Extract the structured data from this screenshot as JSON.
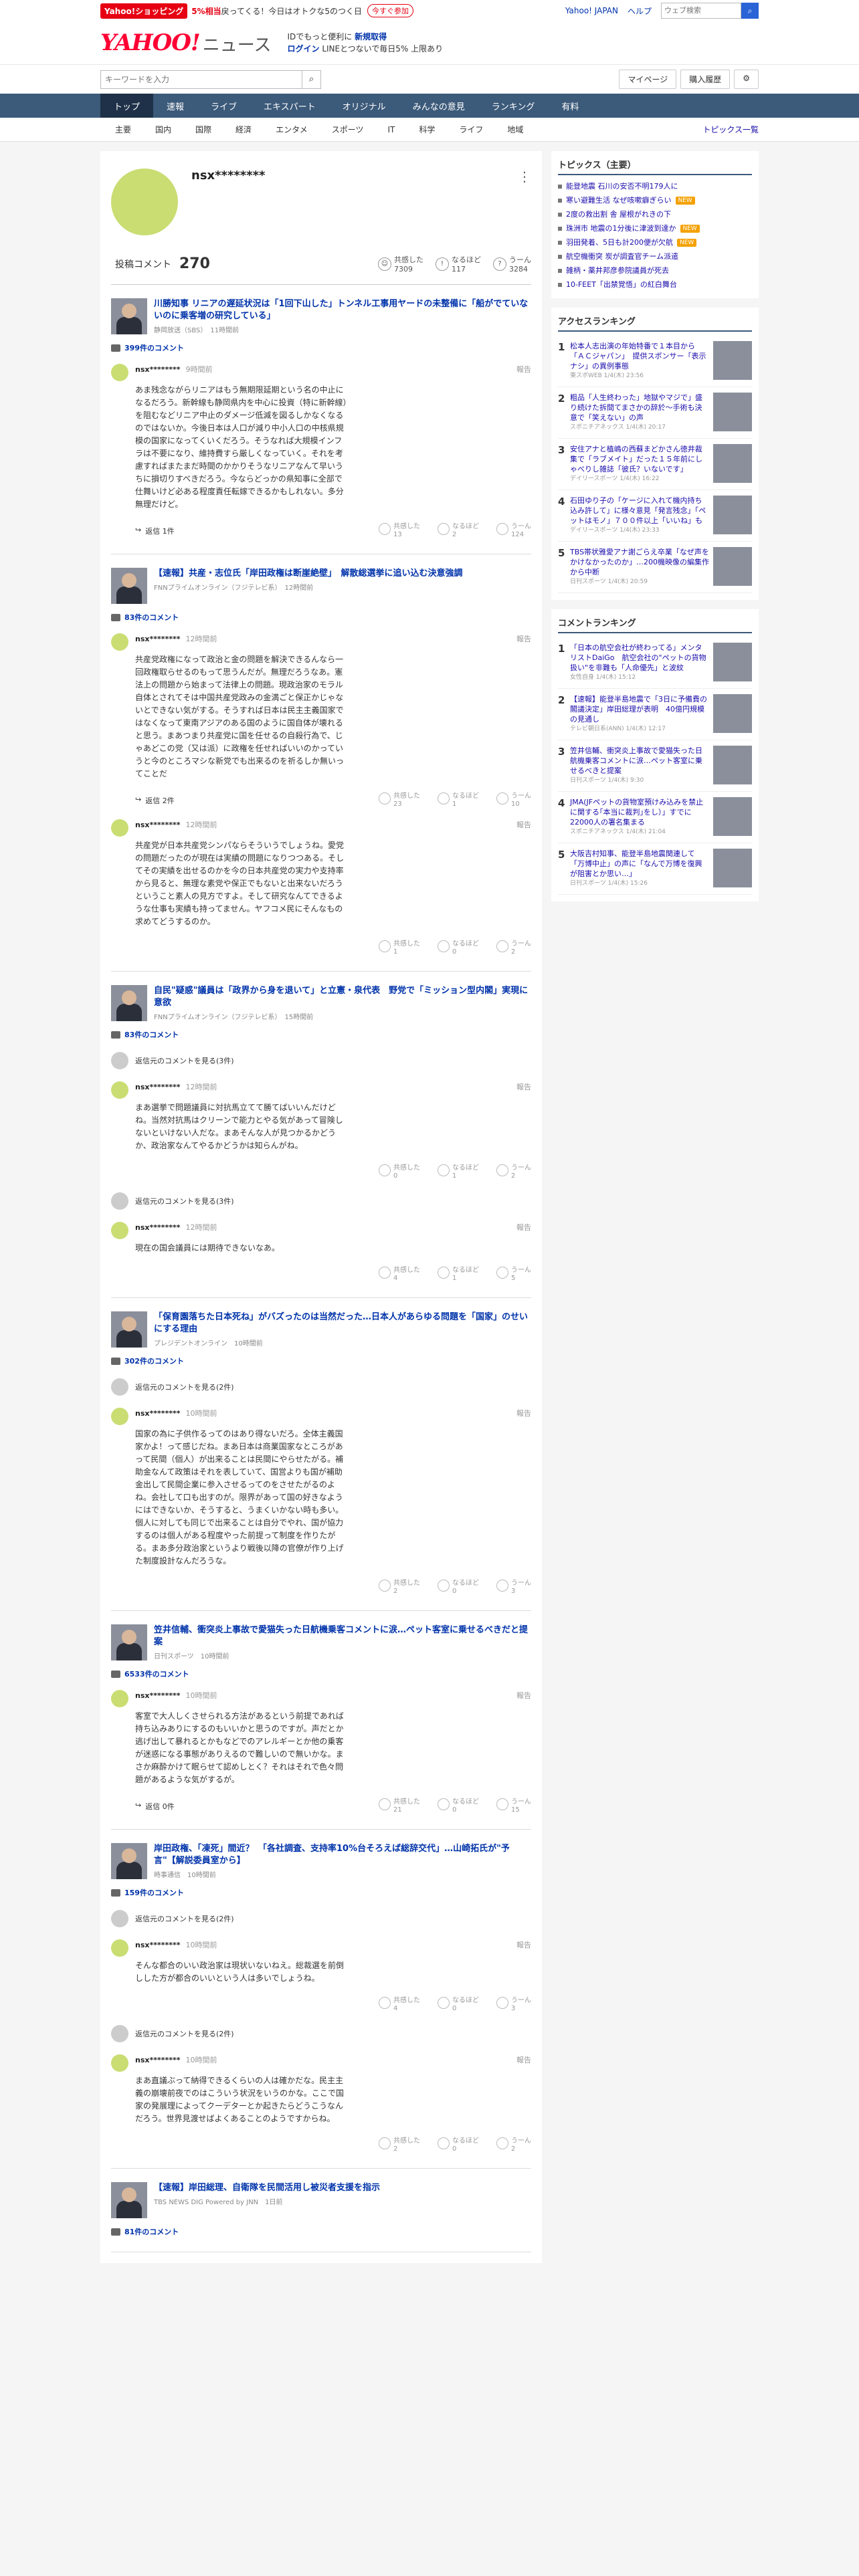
{
  "topbar": {
    "shop": "Yahoo!ショッピング",
    "promo_pre": "5%相当",
    "promo_post": "戻ってくる！今日はオトクな5のつく日",
    "promo_btn": "今すぐ参加",
    "links": [
      "Yahoo! JAPAN",
      "ヘルプ"
    ],
    "search_placeholder": "ウェブ検索"
  },
  "header": {
    "logo": "YAHOO!",
    "logo_sub_text": "JAPAN",
    "site": "ニュース",
    "line1_pre": "IDでもっと便利に",
    "line1_link": "新規取得",
    "line2_login": "ログイン",
    "line2_text": "LINEとつないで毎日5%",
    "line2_tail": "上限あり"
  },
  "searchrow": {
    "placeholder": "キーワードを入力",
    "mypage": "マイページ",
    "buy": "購入履歴"
  },
  "mainnav": [
    "トップ",
    "速報",
    "ライブ",
    "エキスパート",
    "オリジナル",
    "みんなの意見",
    "ランキング",
    "有料"
  ],
  "subnav": {
    "items": [
      "主要",
      "国内",
      "国際",
      "経済",
      "エンタメ",
      "スポーツ",
      "IT",
      "科学",
      "ライフ",
      "地域"
    ],
    "all": "トピックス一覧"
  },
  "profile": {
    "name": "nsx********",
    "comment_label": "投稿コメント",
    "comment_count": "270",
    "kyokan_label": "共感した",
    "kyokan": "7309",
    "naruhodo_label": "なるほど",
    "naruhodo": "117",
    "un_label": "うーん",
    "un": "3284"
  },
  "articles": [
    {
      "title": "川勝知事 リニアの遅延状況は「1回下山した」トンネル工事用ヤードの未整備に「船がでていないのに乗客増の研究している」",
      "src": "静岡放送（SBS）　11時間前",
      "count": "399件のコメント",
      "comments": [
        {
          "user": "nsx********",
          "time": "9時間前",
          "text": "あま残念ながらリニアはもう無期限延期という名の中止になるだろう。新幹線も静岡県内を中心に投資（特に新幹線）を阻むなどリニア中止のダメージ低減を図るしかなくなるのではないか。今後日本は人口が減り中小人口の中核県規模の国家になってくいくだろう。そうなれば大規模インフラは不要になり、維持費すら厳しくなっていく。それを考慮すればまたまだ時間のかかりそうなリニアなんて早いうちに損切りすべきだろう。今ならどっかの県知事に全部で仕舞いけど必ある程度責任転嫁できるかもしれない。多分無理だけど。",
          "reply": "返信 1件",
          "k": "13",
          "n": "2",
          "u": "124"
        }
      ]
    },
    {
      "title": "【速報】共産・志位氏「岸田政権は断崖絶壁」　解散総選挙に追い込む決意強調",
      "src": "FNNプライムオンライン（フジテレビ系）　12時間前",
      "count": "83件のコメント",
      "comments": [
        {
          "user": "nsx********",
          "time": "12時間前",
          "text": "共産党政権になって政治と金の問題を解決できるんなら一回政権取らせるのもって思うんだが。無理だろうなあ。憲法上の問題から始まって法律上の問題。現政治家のモラル自体とされてそは中国共産党政みの金満ごと保正かじゃないとできない気がする。そうすれば日本は民主主義国家ではなくなって東南アジアのある国のように国自体が壊れると思う。まあつまり共産党に国を任せるの自殺行為で、じゃあどこの党（又は派）に政権を任せればいいのかっていうと今のところマシな新党でも出来るのを祈るしか無いってことだ",
          "reply": "返信 2件",
          "k": "23",
          "n": "1",
          "u": "10"
        },
        {
          "user": "nsx********",
          "time": "12時間前",
          "text": "共産党が日本共産党シンパならそういうでしょうね。愛党の問題だったのが現在は実績の問題になりつつある。そしてその実績を出せるのかを今の日本共産党の実力や支持率から見ると、無理な素党や保正でもないと出来ないだろうということ素人の見方ですよ。そして研究なんてできるような仕事も実績も持ってません。ヤフコメ民にそんなもの求めてどうするのか。",
          "reply": "",
          "k": "1",
          "n": "0",
          "u": "2"
        }
      ]
    },
    {
      "title": "自民\"疑惑\"議員は「政界から身を退いて」と立憲・泉代表　野党で「ミッション型内閣」実現に意欲",
      "src": "FNNプライムオンライン（フジテレビ系）　15時間前",
      "count": "83件のコメント",
      "comments": [
        {
          "user": "nsx********",
          "time": "12時間前",
          "text": "まあ選挙で問題議員に対抗馬立てて勝てばいいんだけどね。当然対抗馬はクリーンで能力とやる気があって冒険しないといけない人だな。まあそんな人が見つかるかどうか、政治家なんてやるかどうかは知らんがね。",
          "reply": "",
          "k": "0",
          "n": "1",
          "u": "2"
        },
        {
          "user": "nsx********",
          "time": "12時間前",
          "text": "現在の国会議員には期待できないなあ。",
          "reply": "",
          "k": "4",
          "n": "1",
          "u": "5"
        }
      ]
    },
    {
      "title": "「保育園落ちた日本死ね」がバズったのは当然だった…日本人があらゆる問題を「国家」のせいにする理由",
      "src": "プレジデントオンライン　10時間前",
      "count": "302件のコメント",
      "comments": [
        {
          "user": "nsx********",
          "time": "10時間前",
          "text": "国家の為に子供作るってのはあり得ないだろ。全体主義国家かよ！って感じだね。まあ日本は商業国家なところがあって民間（個人）が出来ることは民間にやらせたがる。補助金なんて政策はそれを表していて、国営よりも国が補助金出して民間企業に参入させるってのをさせたがるのよね。会社して口も出すのが。限界があって国の好きなようにはできないか、そうすると、うまくいかない時も多い。個人に対しても同じで出来ることは自分でやれ、国が協力するのは個人がある程度やった前提って制度を作りたがる。まあ多分政治家というより戦後以降の官僚が作り上げた制度設計なんだろうな。",
          "reply": "",
          "k": "2",
          "n": "0",
          "u": "3"
        }
      ]
    },
    {
      "title": "笠井信輔、衝突炎上事故で愛猫失った日航機乗客コメントに涙…ペット客室に乗せるべきだと提案",
      "src": "日刊スポーツ　10時間前",
      "count": "6533件のコメント",
      "comments": [
        {
          "user": "nsx********",
          "time": "10時間前",
          "text": "客室で大人しくさせられる方法があるという前提であれば持ち込みありにするのもいいかと思うのですが。声だとか逃げ出して暴れるとかもなどでのアレルギーとか他の乗客が迷惑になる事態がありえるので難しいので無いかな。まさか麻酔かけて眠らせて認めしとく？それはそれで色々問題があるような気がするが。",
          "reply": "返信 0件",
          "k": "21",
          "n": "0",
          "u": "15"
        }
      ]
    },
    {
      "title": "岸田政権、「凍死」間近？　「各社調査、支持率10%台そろえば総辞交代」…山崎拓氏が\"予言\"【解説委員室から】",
      "src": "時事通信　10時間前",
      "count": "159件のコメント",
      "comments": [
        {
          "user": "nsx********",
          "time": "10時間前",
          "text": "そんな都合のいい政治家は現状いないねえ。総裁選を前倒しした方が都合のいいという人は多いでしょうね。",
          "reply": "",
          "k": "4",
          "n": "0",
          "u": "3"
        },
        {
          "user": "nsx********",
          "time": "10時間前",
          "text": "まあ直議ぶって納得できるくらいの人は確かだな。民主主義の崩壊前夜でのはこういう状況をいうのかな。ここで国家の発展理によってクーデターとか起きたらどうこうなんだろう。世界見渡せばよくあることのようですからね。",
          "reply": "",
          "k": "2",
          "n": "0",
          "u": "2"
        }
      ]
    },
    {
      "title": "【速報】岸田総理、自衛隊を民間活用し被災者支援を指示",
      "src": "TBS NEWS DIG Powered by JNN　1日前",
      "count": "81件のコメント",
      "comments": []
    }
  ],
  "misc": {
    "show_parent": "返信元のコメントを見る(3件)",
    "show_parent2": "返信元のコメントを見る(2件)",
    "report": "報告"
  },
  "sidebar": {
    "topics_head": "トピックス（主要）",
    "topics": [
      "能登地震 石川の安否不明179人に",
      "寒い避難生活 なぜ咳嗽癖ぎらい",
      "2度の救出割 舎 屋根がれきの下",
      "珠洲市 地震の1分後に津波到達か",
      "羽田発着、5日も計200便が欠航",
      "航空機衝突 炭が調査官チーム派遣",
      "雑柄・薬井邦彦参院議員が死去",
      "10-FEET「出禁覚悟」の紅白舞台"
    ],
    "access_head": "アクセスランキング",
    "access": [
      {
        "t": "松本人志出演の年始特番で１本目から「ＡＣジャパン」　提供スポンサー「表示ナシ」の異例事態",
        "s": "東スポWEB 1/4(木) 23:56"
      },
      {
        "t": "粗品「人生終わった」地獄やマジで」盛り続けた拆間てまさかの辞於～手術も決意で「笑えない」の声",
        "s": "スポニチアネックス 1/4(木) 20:17"
      },
      {
        "t": "安住アナと植嶋の西蘇まどかさん徳井裁集で「ラブメイト」だった１５年前にしゃべりし雑誌「彼氏？いないです」",
        "s": "デイリースポーツ 1/4(木) 16:22"
      },
      {
        "t": "石田ゆり子の「ケージに入れて機内持ち込み許して」に様々意見「発言残念」「ペットはモノ」７００件以上「いいね」も",
        "s": "デイリースポーツ 1/4(木) 23:33"
      },
      {
        "t": "TBS帯状雅愛アナ謝ごらえ卒業「なぜ声をかけなかったのか」…200機映像の編集作から中断",
        "s": "日刊スポーツ 1/4(木) 20:59"
      }
    ],
    "comment_head": "コメントランキング",
    "crank": [
      {
        "t": "「日本の航空会社が終わってる」メンタリストDaiGo　航空会社の\"ペットの貨物扱い\"を非難も「人命優先」と波紋",
        "s": "女性自身 1/4(木) 15:12"
      },
      {
        "t": "【速報】能登半島地震で「3日に予備費の閣議決定」岸田総理が表明　40億円規模の見通し",
        "s": "テレビ朝日系(ANN) 1/4(木) 12:17"
      },
      {
        "t": "笠井信輔、衝突炎上事故で愛猫失った日航機乗客コメントに涙…ペット客室に乗せるべきと提案",
        "s": "日刊スポーツ 1/4(木) 9:30"
      },
      {
        "t": "JMA(JFペットの貨物室預けみ込みを禁止に関する｢本当に裁判｣をし）」すでに22000人の署名集まる",
        "s": "スポニチアネックス 1/4(木) 21:04"
      },
      {
        "t": "大阪吉村知事、能登半島地震関連して「万博中止」の声に「なんで万博を復興が阻害とか思い…」",
        "s": "日刊スポーツ 1/4(木) 15:26"
      }
    ]
  }
}
